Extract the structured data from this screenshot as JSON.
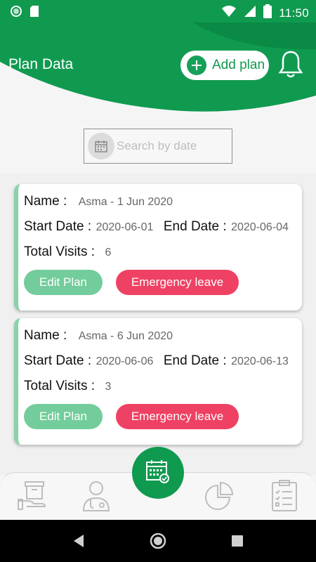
{
  "status_bar": {
    "time": "11:50"
  },
  "header": {
    "title": "Plan Data",
    "add_plan_label": "Add plan"
  },
  "search": {
    "placeholder": "Search by date",
    "value": ""
  },
  "plans": [
    {
      "name_label": "Name :",
      "name_value": "Asma - 1  Jun 2020",
      "start_label": "Start Date :",
      "start_value": "2020-06-01",
      "end_label": "End Date :",
      "end_value": "2020-06-04",
      "visits_label": "Total Visits :",
      "visits_value": "6",
      "edit_label": "Edit Plan",
      "leave_label": "Emergency leave"
    },
    {
      "name_label": "Name :",
      "name_value": "Asma - 6  Jun 2020",
      "start_label": "Start Date :",
      "start_value": "2020-06-06",
      "end_label": "End Date :",
      "end_value": "2020-06-13",
      "visits_label": "Total Visits :",
      "visits_value": "3",
      "edit_label": "Edit Plan",
      "leave_label": "Emergency leave"
    }
  ],
  "bottom_nav": {
    "items": [
      "box-hand-icon",
      "doctor-icon",
      "calendar-check-icon",
      "pie-chart-icon",
      "clipboard-checklist-icon"
    ]
  },
  "colors": {
    "primary": "#0f9a4f",
    "edit": "#73cc9b",
    "leave": "#ef4163"
  }
}
